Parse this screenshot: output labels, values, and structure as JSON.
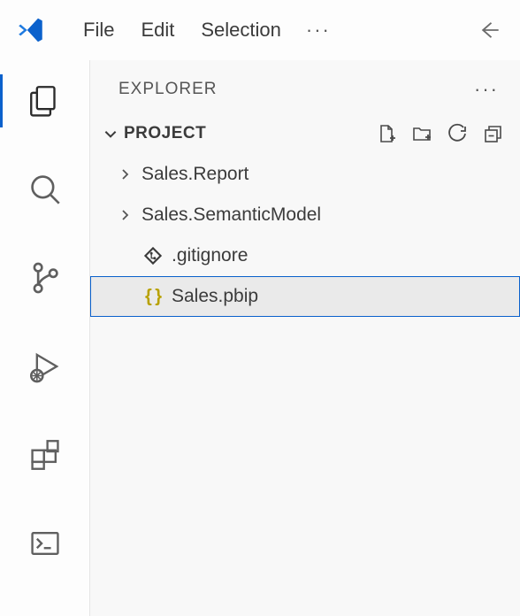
{
  "menu": {
    "items": [
      "File",
      "Edit",
      "Selection"
    ],
    "overflow": "···"
  },
  "sidebar": {
    "title": "EXPLORER",
    "actions_overflow": "···",
    "section": {
      "label": "PROJECT"
    }
  },
  "tree": {
    "items": [
      {
        "label": "Sales.Report"
      },
      {
        "label": "Sales.SemanticModel"
      },
      {
        "label": ".gitignore"
      },
      {
        "label": "Sales.pbip"
      }
    ]
  }
}
